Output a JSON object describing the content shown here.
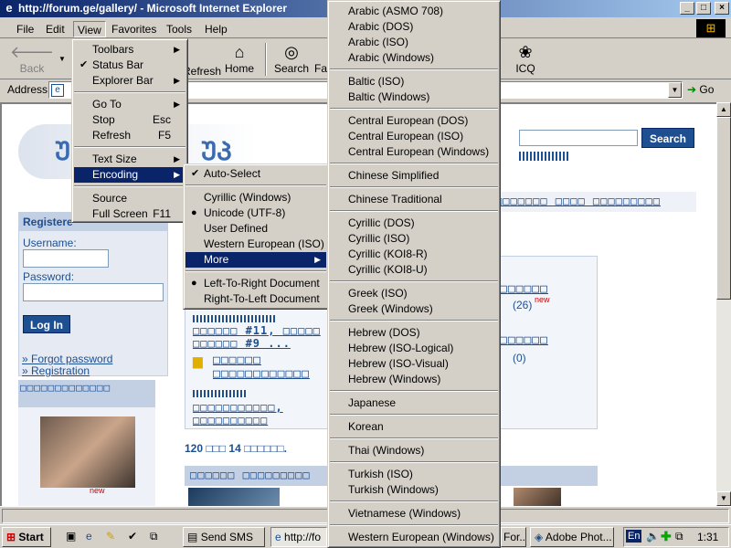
{
  "window": {
    "title": "http://forum.ge/gallery/ - Microsoft Internet Explorer"
  },
  "menubar": {
    "items": [
      "File",
      "Edit",
      "View",
      "Favorites",
      "Tools",
      "Help"
    ]
  },
  "toolbar": {
    "back": "Back",
    "refresh": "Refresh",
    "home": "Home",
    "search": "Search",
    "favorites": "Fa",
    "icq": "ICQ"
  },
  "address": {
    "label": "Address",
    "value": "",
    "go": "Go"
  },
  "view_menu": {
    "items": [
      {
        "label": "Toolbars",
        "submenu": true
      },
      {
        "label": "Status Bar",
        "checked": true
      },
      {
        "label": "Explorer Bar",
        "submenu": true
      },
      {
        "label": "Go To",
        "submenu": true
      },
      {
        "label": "Stop",
        "shortcut": "Esc"
      },
      {
        "label": "Refresh",
        "shortcut": "F5"
      },
      {
        "label": "Text Size",
        "submenu": true
      },
      {
        "label": "Encoding",
        "submenu": true,
        "highlighted": true
      },
      {
        "label": "Source"
      },
      {
        "label": "Full Screen",
        "shortcut": "F11"
      }
    ]
  },
  "encoding_menu": {
    "items": [
      {
        "label": "Auto-Select",
        "checked": true
      },
      {
        "label": "Cyrillic (Windows)"
      },
      {
        "label": "Unicode (UTF-8)",
        "bullet": true
      },
      {
        "label": "User Defined"
      },
      {
        "label": "Western European (ISO)"
      },
      {
        "label": "More",
        "submenu": true,
        "highlighted": true
      },
      {
        "label": "Left-To-Right Document",
        "bullet": true
      },
      {
        "label": "Right-To-Left Document"
      }
    ]
  },
  "more_menu": {
    "groups": [
      [
        "Arabic (ASMO 708)",
        "Arabic (DOS)",
        "Arabic (ISO)",
        "Arabic (Windows)"
      ],
      [
        "Baltic (ISO)",
        "Baltic (Windows)"
      ],
      [
        "Central European (DOS)",
        "Central European (ISO)",
        "Central European (Windows)"
      ],
      [
        "Chinese Simplified"
      ],
      [
        "Chinese Traditional"
      ],
      [
        "Cyrillic (DOS)",
        "Cyrillic (ISO)",
        "Cyrillic (KOI8-R)",
        "Cyrillic (KOI8-U)"
      ],
      [
        "Greek (ISO)",
        "Greek (Windows)"
      ],
      [
        "Hebrew (DOS)",
        "Hebrew (ISO-Logical)",
        "Hebrew (ISO-Visual)",
        "Hebrew (Windows)"
      ],
      [
        "Japanese"
      ],
      [
        "Korean"
      ],
      [
        "Thai (Windows)"
      ],
      [
        "Turkish (ISO)",
        "Turkish (Windows)"
      ],
      [
        "Vietnamese (Windows)"
      ],
      [
        "Western European (Windows)"
      ]
    ]
  },
  "page": {
    "search_button": "Search",
    "register_header": "Registere",
    "username_label": "Username:",
    "password_label": "Password:",
    "login_button": "Log In",
    "forgot_password": "» Forgot password",
    "registration": "» Registration",
    "geo_header_left": "□□□□□□□□□□□□□",
    "geo_nav": "□□□□□□□  □□□□ □□□□□□□□□",
    "geo_item1": "□□□□□□ #11, □□□□□",
    "geo_item2": "□□□□□□ #9 ...",
    "geo_folder": "□□□□□□ □□□□□□□□□□□□",
    "geo_folder2": "□□□□□□□□□□□,",
    "geo_folder3": "□□□□□□□□□□",
    "count1": "(26)",
    "new1": "new",
    "count2": "(0)",
    "bottom_line": "120 □□□ 14 □□□□□□.",
    "bottom_header": "□□□□□□ □□□□□□□□□",
    "new2": "new",
    "geo_right1": "□□□□□□",
    "geo_right2": "□□□□□□"
  },
  "taskbar": {
    "start": "Start",
    "tasks": [
      "Send SMS",
      "http://fo",
      "For...",
      "Adobe Phot..."
    ],
    "lang": "En",
    "clock": "1:31"
  }
}
